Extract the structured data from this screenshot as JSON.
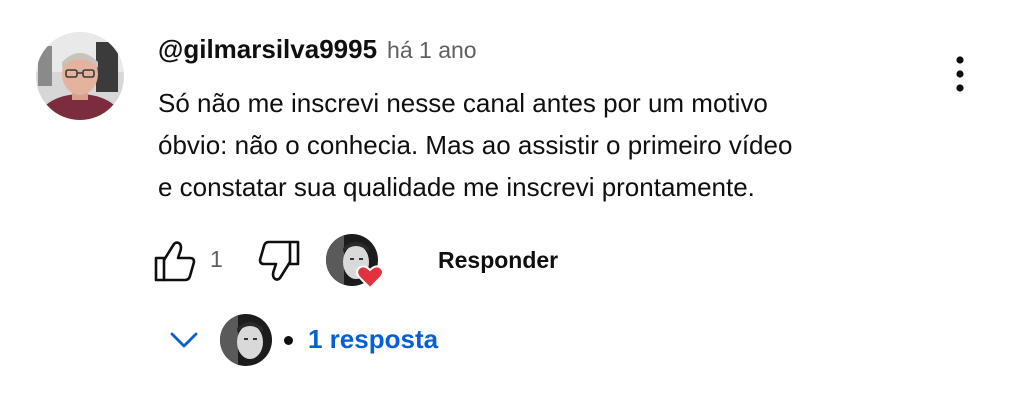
{
  "comment": {
    "author": "@gilmarsilva9995",
    "timestamp": "há 1 ano",
    "text_lines": [
      "Só não me inscrevi nesse canal antes por um motivo",
      "óbvio: não o conhecia. Mas ao assistir o primeiro vídeo",
      "e constatar sua qualidade me inscrevi prontamente."
    ],
    "like_count": "1",
    "reply_label": "Responder",
    "creator_heart": true
  },
  "replies": {
    "label": "1 resposta"
  },
  "icons": {
    "menu": "more-vert-icon",
    "like": "thumb-up-icon",
    "dislike": "thumb-down-icon",
    "heart": "heart-icon",
    "expand": "chevron-down-icon"
  },
  "colors": {
    "link": "#065fd4",
    "heart": "#e1323d",
    "meta": "#606060"
  }
}
